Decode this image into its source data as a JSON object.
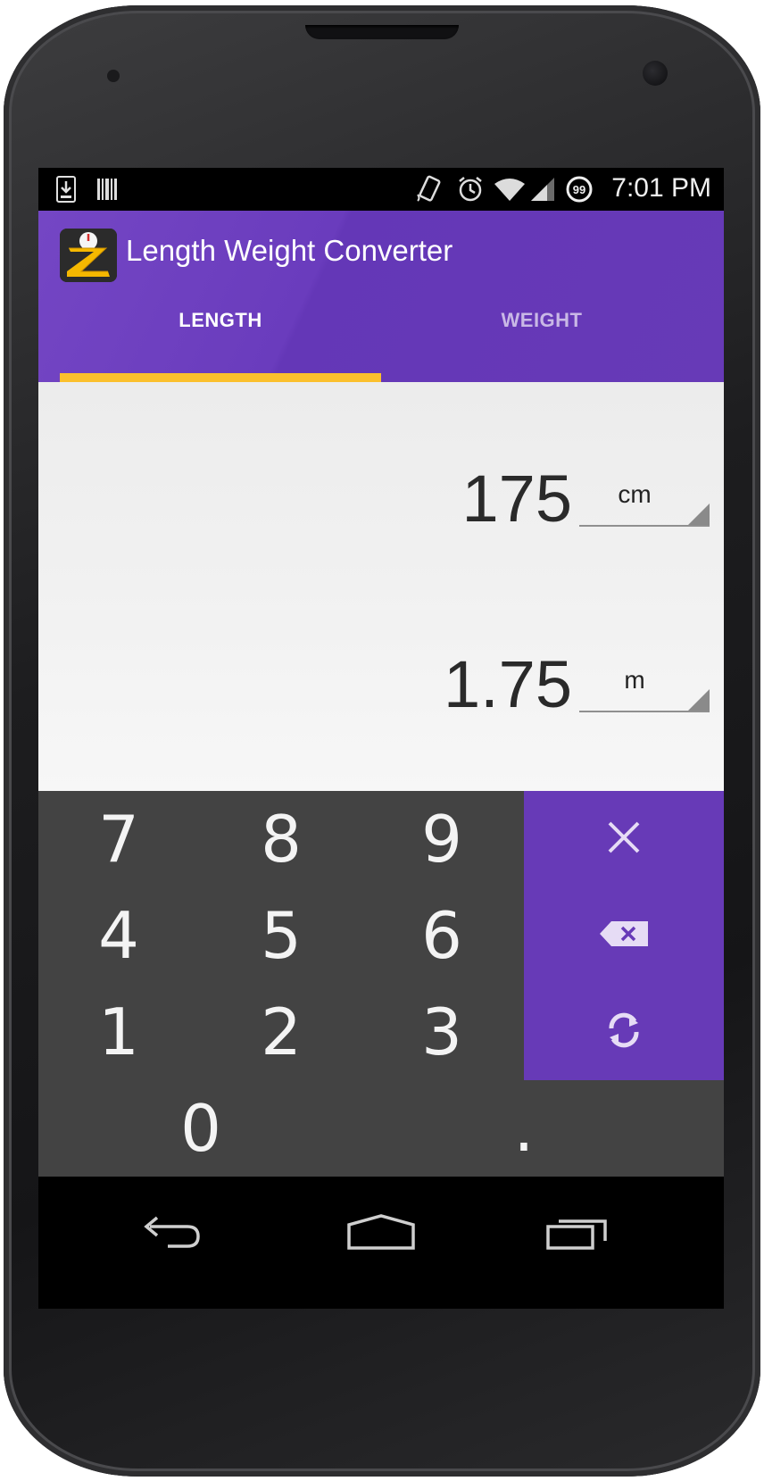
{
  "status_bar": {
    "time": "7:01 PM",
    "icons": [
      "download-icon",
      "barcode-icon",
      "vibrate-icon",
      "alarm-icon",
      "wifi-icon",
      "signal-icon",
      "battery-icon"
    ],
    "battery_level": "99"
  },
  "app": {
    "title": "Length Weight Converter",
    "logo": "app-logo-icon",
    "accent_color": "#673ab7",
    "indicator_color": "#fbc02d"
  },
  "tabs": [
    {
      "label": "LENGTH",
      "selected": true
    },
    {
      "label": "WEIGHT",
      "selected": false
    }
  ],
  "conversion": {
    "input_value": "175",
    "input_unit": "cm",
    "output_value": "1.75",
    "output_unit": "m"
  },
  "keypad": {
    "keys": [
      "7",
      "8",
      "9",
      "4",
      "5",
      "6",
      "1",
      "2",
      "3",
      "0",
      "."
    ],
    "ops": [
      "clear-icon",
      "backspace-icon",
      "swap-icon"
    ]
  },
  "nav_bar": {
    "buttons": [
      "back-icon",
      "home-icon",
      "recents-icon"
    ]
  }
}
